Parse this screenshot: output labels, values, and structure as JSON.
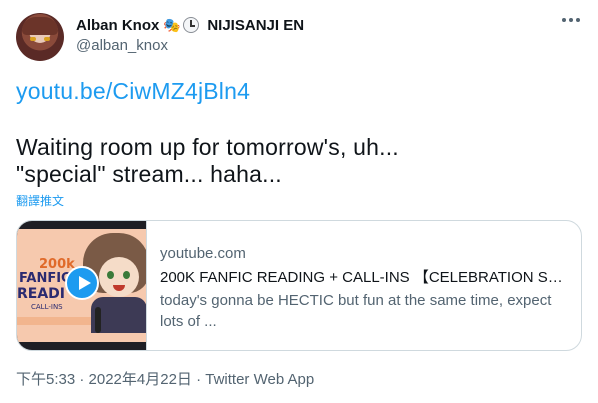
{
  "tweet": {
    "author": {
      "display_name": "Alban Knox",
      "org": "NIJISANJI EN",
      "handle": "@alban_knox",
      "emojis": [
        "performing-arts-icon",
        "clock-icon"
      ]
    },
    "link_text": "youtu.be/CiwMZ4jBln4",
    "lines": [
      "Waiting room up for tomorrow's, uh...",
      "\"special\" stream... haha..."
    ],
    "translate_label": "翻譯推文",
    "card": {
      "domain": "youtube.com",
      "title": "200K FANFIC READING + CALL-INS 【CELEBRATION STR...",
      "description": "today's gonna be HECTIC but fun at the same time, expect lots of ...",
      "thumbnail_text": {
        "count": "200k",
        "line1": "FANFIC",
        "line2": "READI",
        "line3": "CALL-INS"
      }
    },
    "meta": "下午5:33 · 2022年4月22日 · Twitter Web App"
  },
  "colors": {
    "accent": "#1d9bf0",
    "text": "#0f1419",
    "secondary": "#536471",
    "border": "#cfd9de"
  }
}
